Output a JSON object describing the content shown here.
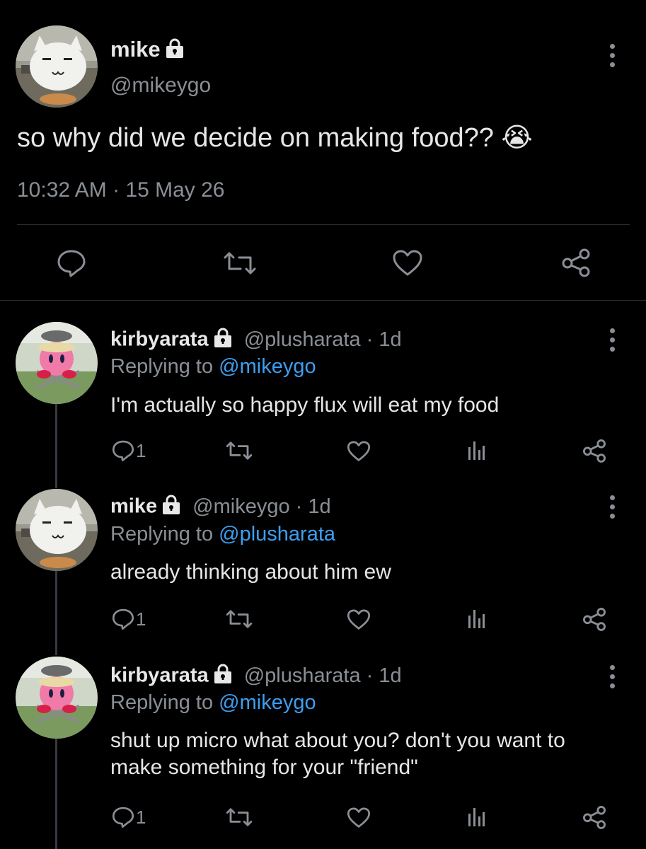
{
  "main_tweet": {
    "name": "mike",
    "handle": "@mikeygo",
    "text": "so why did we decide on making food?? 😭",
    "timestamp": "10:32 AM · 15 May 26"
  },
  "replies": [
    {
      "name": "kirbyarata",
      "meta": "@plusharata · 1d",
      "replying_prefix": "Replying to ",
      "replying_to": "@mikeygo",
      "text": "I'm actually so happy flux will eat my food",
      "reply_count": "1"
    },
    {
      "name": "mike",
      "meta": "@mikeygo · 1d",
      "replying_prefix": "Replying to ",
      "replying_to": "@plusharata",
      "text": "already thinking about him ew",
      "reply_count": "1"
    },
    {
      "name": "kirbyarata",
      "meta": "@plusharata · 1d",
      "replying_prefix": "Replying to ",
      "replying_to": "@mikeygo",
      "text": "shut up micro what about you? don't you want to make something for your \"friend\"",
      "reply_count": "1"
    }
  ],
  "colors": {
    "background": "#000000",
    "secondary_text": "#8a8f95",
    "mention": "#3d9ef0"
  },
  "icons": [
    "lock-icon",
    "more-icon",
    "reply-icon",
    "retweet-icon",
    "like-icon",
    "share-icon",
    "analytics-icon"
  ]
}
